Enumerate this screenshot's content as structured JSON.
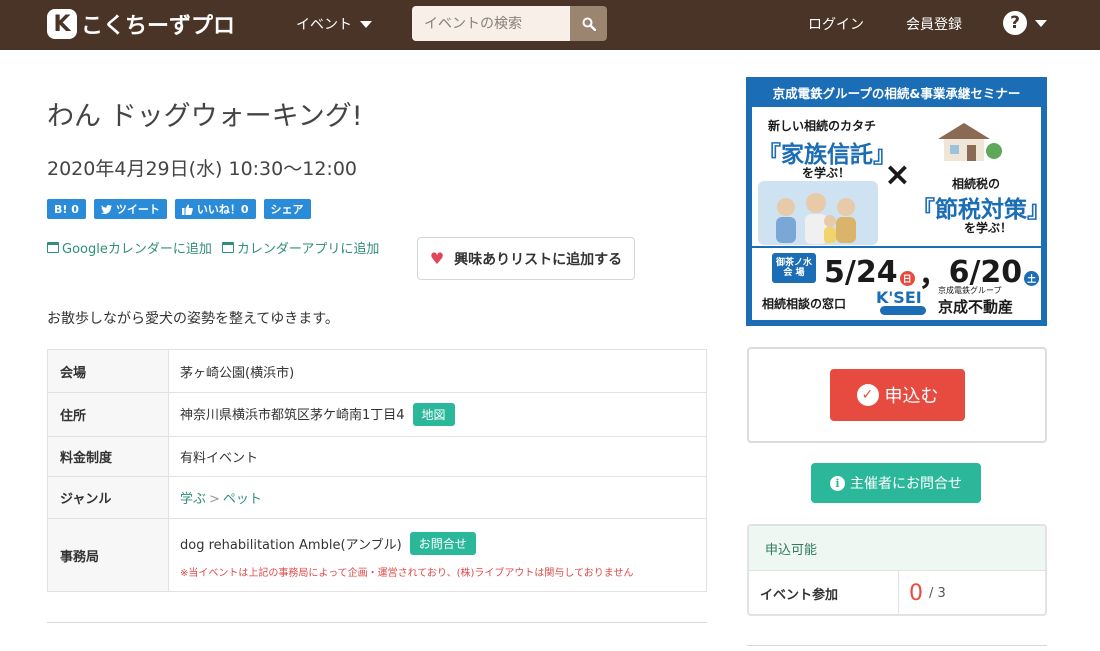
{
  "navbar": {
    "logo_mark": "K",
    "logo_text": "こくちーずプロ",
    "event_menu": "イベント",
    "search_placeholder": "イベントの検索",
    "login": "ログイン",
    "register": "会員登録",
    "help": "?"
  },
  "event": {
    "title": "わん ドッグウォーキング!",
    "datetime": "2020年4月29日(水) 10:30〜12:00",
    "description": "お散歩しながら愛犬の姿勢を整えてゆきます。"
  },
  "share": {
    "hatena": "B! 0",
    "tweet": "ツイート",
    "like": "いいね！0",
    "share": "シェア"
  },
  "calendar": {
    "google": "Googleカレンダーに追加",
    "app": "カレンダーアプリに追加"
  },
  "interest_button": "興味ありリストに追加する",
  "details": {
    "venue_label": "会場",
    "venue": "茅ヶ崎公園(横浜市)",
    "address_label": "住所",
    "address": "神奈川県横浜市都筑区茅ケ崎南1丁目4",
    "map_button": "地図",
    "fee_label": "料金制度",
    "fee": "有料イベント",
    "genre_label": "ジャンル",
    "genre_1": "学ぶ",
    "genre_sep": ">",
    "genre_2": "ペット",
    "office_label": "事務局",
    "office": "dog rehabilitation Amble(アンブル)",
    "inquiry_button": "お問合せ",
    "office_note": "※当イベントは上記の事務局によって企画・運営されており、(株)ライブアウトは関与しておりません"
  },
  "banner": {
    "header": "京成電鉄グループの相続&事業承継セミナー",
    "left_title": "新しい相続のカタチ",
    "left_big": "『家族信託』",
    "learn": "を学ぶ！",
    "cross": "×",
    "right_title": "相続税の",
    "right_big": "『節税対策』",
    "venue": "御茶ノ水\n会 場",
    "date1": "5/24",
    "day1": "日",
    "comma": "，",
    "date2": "6/20",
    "day2": "土",
    "consult": "相続相談の窓口",
    "kisei": "K'SEI",
    "keisei_small": "京成電鉄グループ",
    "keisei_big": "京成不動産"
  },
  "apply_button": "申込む",
  "contact_button": "主催者にお問合せ",
  "status": {
    "state": "申込可能",
    "label": "イベント参加",
    "count": "0",
    "capacity": "/ 3"
  },
  "colors": {
    "navbar": "#4a3427",
    "accent_green": "#2bb89a",
    "apply_red": "#e74b3f",
    "share_blue": "#2a8cd8",
    "banner_blue": "#1b6db5"
  }
}
